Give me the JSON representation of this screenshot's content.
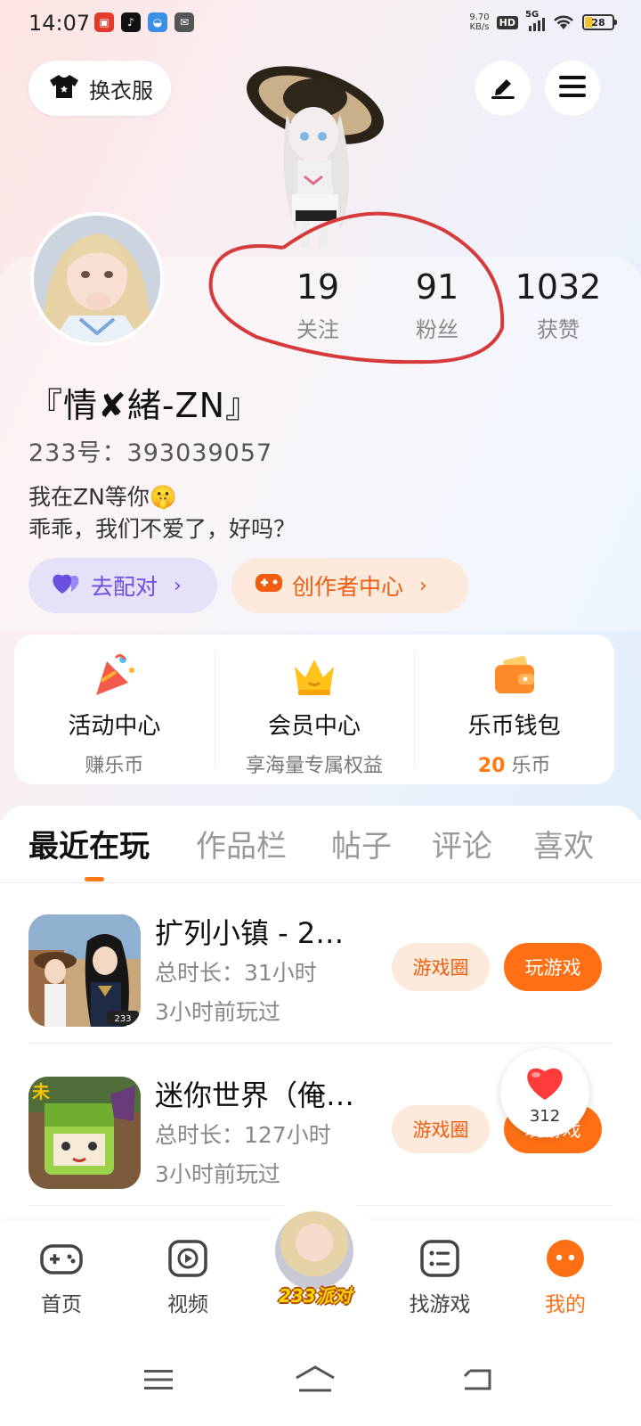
{
  "status_bar": {
    "time": "14:07",
    "net_speed_value": "9.70",
    "net_speed_unit": "KB/s",
    "hd": "HD",
    "network": "5G",
    "battery": "28"
  },
  "header": {
    "dress_label": "换衣服",
    "edit_icon": "pencil-icon",
    "menu_icon": "hamburger-menu-icon"
  },
  "profile": {
    "stats": [
      {
        "value": "19",
        "label": "关注"
      },
      {
        "value": "91",
        "label": "粉丝"
      },
      {
        "value": "1032",
        "label": "获赞"
      }
    ],
    "nickname": "『情✘緒-ZN』",
    "uid_label": "233号：",
    "uid_value": "393039057",
    "bio_line1": "我在ZN等你🤫",
    "bio_line2": "乖乖，我们不爱了，好吗？",
    "pair_button": "去配对",
    "creator_button": "创作者中心"
  },
  "services": [
    {
      "title": "活动中心",
      "subtitle": "赚乐币",
      "icon": "party-popper-icon"
    },
    {
      "title": "会员中心",
      "subtitle": "享海量专属权益",
      "icon": "crown-icon"
    },
    {
      "title": "乐币钱包",
      "coin_amount": "20",
      "coin_unit": "乐币",
      "icon": "wallet-icon"
    }
  ],
  "tabs": [
    "最近在玩",
    "作品栏",
    "帖子",
    "评论",
    "喜欢"
  ],
  "active_tab": "最近在玩",
  "games": [
    {
      "name": "扩列小镇 - 2…",
      "duration": "总时长：31小时",
      "last_played": "3小时前玩过",
      "circle_label": "游戏圈",
      "play_label": "玩游戏"
    },
    {
      "name": "迷你世界（俺…",
      "duration": "总时长：127小时",
      "last_played": "3小时前玩过",
      "circle_label": "游戏圈",
      "play_label": "玩游戏"
    }
  ],
  "floating_like": {
    "count": "312"
  },
  "bottom_nav": [
    {
      "label": "首页",
      "icon": "gamepad-icon"
    },
    {
      "label": "视频",
      "icon": "video-play-icon"
    },
    {
      "label": "233派对",
      "icon": "party-avatar-icon"
    },
    {
      "label": "找游戏",
      "icon": "list-icon"
    },
    {
      "label": "我的",
      "icon": "profile-dots-icon"
    }
  ],
  "colors": {
    "accent": "#ff7014",
    "pair_purple": "#6a4fe0",
    "annotation_red": "#d63a3a"
  }
}
